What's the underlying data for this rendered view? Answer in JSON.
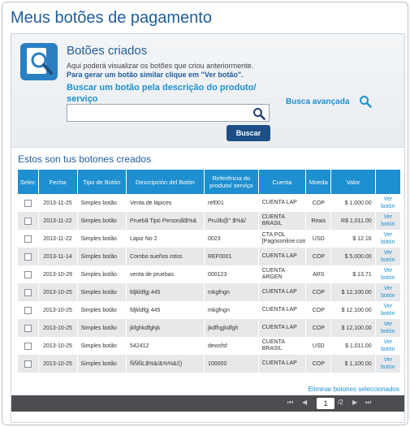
{
  "page_title": "Meus botões de pagamento",
  "section": {
    "title": "Botões criados",
    "desc_line1": "Aqui poderá visualizar os botões que criou anteriormente.",
    "desc_line2": "Para gerar um botão similar clique em \"Ver botão\".",
    "search_label": "Buscar um botão pela descrição do produto/ serviço",
    "search_value": "",
    "search_button": "Buscar",
    "advanced_search": "Busca avançada"
  },
  "list_title": "Estos son tus botones creados",
  "table": {
    "headers": [
      "Selec",
      "Fecha",
      "Tipo de Botón",
      "Descripción del Botón",
      "Referência do produto/ serviço",
      "Cuenta",
      "Moeda",
      "Valor",
      ""
    ],
    "rows": [
      {
        "fecha": "2013-11-25",
        "tipo": "Simples botão",
        "desc": "Venta de lápices",
        "ref": "ref001",
        "cuenta": "CUENTA LAP",
        "moeda": "COP",
        "valor": "$ 1,000.00",
        "link": "Ver botón"
      },
      {
        "fecha": "2013-11-22",
        "tipo": "Simples botão",
        "desc": "Pruebã Tipó Personãl$%&",
        "ref": "Pru3b@\" $%&/",
        "cuenta": "CUENTA BRASIL",
        "moeda": "Reais",
        "valor": "R$ 1,011.00",
        "link": "Ver botón"
      },
      {
        "fecha": "2013-11-22",
        "tipo": "Simples botão",
        "desc": "Lapiz No 2",
        "ref": "0023",
        "cuenta": "CTA POL [Pagosonline.com",
        "moeda": "USD",
        "valor": "$ 12.16",
        "link": "Ver botón"
      },
      {
        "fecha": "2013-11-14",
        "tipo": "Simples botão",
        "desc": "Combo sueños rotos",
        "ref": "REF0001",
        "cuenta": "CUENTA LAP",
        "moeda": "COP",
        "valor": "$ 5,000.00",
        "link": "Ver botón"
      },
      {
        "fecha": "2013-10-29",
        "tipo": "Simples botão",
        "desc": "venta de pruebas",
        "ref": "000123",
        "cuenta": "CUENTA ARGEN",
        "moeda": "ARS",
        "valor": "$ 13.71",
        "link": "Ver botón"
      },
      {
        "fecha": "2013-10-25",
        "tipo": "Simples botão",
        "desc": "fdjkldfgj 445",
        "ref": "mkgfngn",
        "cuenta": "CUENTA LAP",
        "moeda": "COP",
        "valor": "$ 12,100.00",
        "link": "Ver botón"
      },
      {
        "fecha": "2013-10-25",
        "tipo": "Simples botão",
        "desc": "fdjkldfgj 445",
        "ref": "mkgfngn",
        "cuenta": "CUENTA LAP",
        "moeda": "COP",
        "valor": "$ 12,100.00",
        "link": "Ver botón"
      },
      {
        "fecha": "2013-10-25",
        "tipo": "Simples botão",
        "desc": "jkfghkdfghjk",
        "ref": "jkdfhgjkdfgh",
        "cuenta": "CUENTA LAP",
        "moeda": "COP",
        "valor": "$ 12,100.00",
        "link": "Ver botón"
      },
      {
        "fecha": "2013-10-25",
        "tipo": "Simples botão",
        "desc": "542412",
        "ref": "dewsfsf",
        "cuenta": "CUENTA BRASIL",
        "moeda": "USD",
        "valor": "$ 1,011.00",
        "link": "Ver botón"
      },
      {
        "fecha": "2013-10-25",
        "tipo": "Simples botão",
        "desc": "ÑÑÑL$%&/&%%&/()",
        "ref": "100000",
        "cuenta": "CUENTA LAP",
        "moeda": "COP",
        "valor": "$ 1,100.00",
        "link": "Ver botón"
      }
    ]
  },
  "delete_selected": "Eliminar botones seleccionados",
  "pager": {
    "first": "⏮",
    "prev": "◀",
    "current_page": "1",
    "total": "/2",
    "next": "▶",
    "last": "⏭"
  },
  "colors": {
    "accent": "#1e8fd0",
    "title": "#1f5d9a",
    "button": "#1d4f86",
    "pager_bg": "#4b4d50"
  }
}
